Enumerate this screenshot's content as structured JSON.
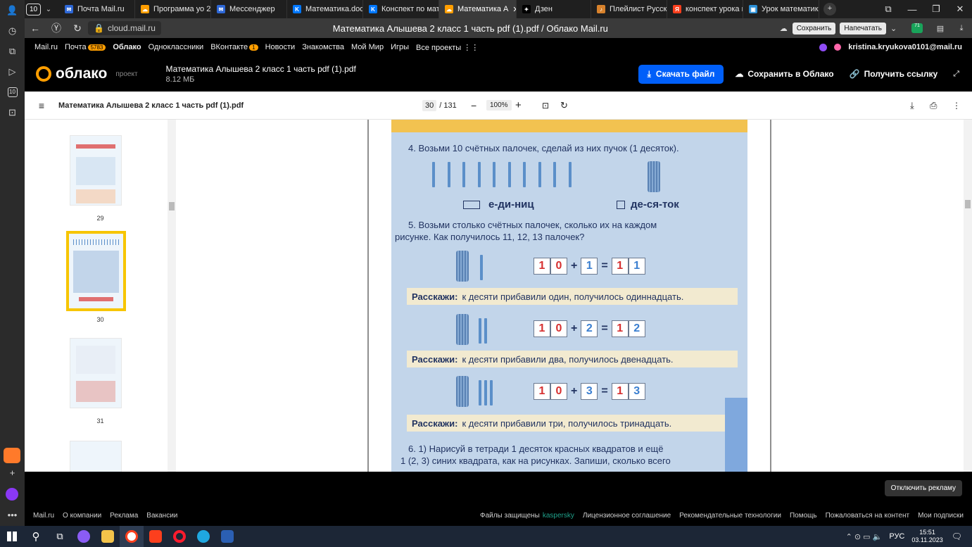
{
  "browser": {
    "tab_count": "10",
    "tabs": [
      {
        "label": "Почта Mail.ru",
        "color": "#2d67d6",
        "glyph": "✉"
      },
      {
        "label": "Программа уо 2",
        "color": "#ff9e00",
        "glyph": "☁"
      },
      {
        "label": "Мессенджер",
        "color": "#2d67d6",
        "glyph": "✉"
      },
      {
        "label": "Математика.doc",
        "color": "#0077ff",
        "glyph": "K"
      },
      {
        "label": "Конспект по мат",
        "color": "#0077ff",
        "glyph": "K"
      },
      {
        "label": "Математика А",
        "color": "#ff9e00",
        "glyph": "☁",
        "active": true
      },
      {
        "label": "Дзен",
        "color": "#000000",
        "glyph": "✦"
      },
      {
        "label": "Плейлист Русско",
        "color": "#d8822c",
        "glyph": "♪"
      },
      {
        "label": "конспект урока м",
        "color": "#fc3f1d",
        "glyph": "Я"
      },
      {
        "label": "Урок математик",
        "color": "#2a8fd6",
        "glyph": "▣"
      }
    ],
    "url": "cloud.mail.ru",
    "page_title": "Математика Алышева 2 класс 1 часть pdf (1).pdf / Облако Mail.ru",
    "save_btn": "Сохранить",
    "print_btn": "Напечатать",
    "ext_badge": "71"
  },
  "portal": {
    "links": [
      "Mail.ru",
      "Почта",
      "Облако",
      "Одноклассники",
      "ВКонтакте",
      "Новости",
      "Знакомства",
      "Мой Мир",
      "Игры",
      "Все проекты"
    ],
    "mail_badge": "5783",
    "vk_badge": "1",
    "user": "kristina.kryukova0101@mail.ru"
  },
  "cloud": {
    "logo": "облако",
    "project_label": "проект",
    "file_name": "Математика Алышева 2 класс 1 часть pdf (1).pdf",
    "file_size": "8.12 МБ",
    "download": "Скачать файл",
    "save_to_cloud": "Сохранить в Облако",
    "get_link": "Получить ссылку"
  },
  "viewer": {
    "doc_title": "Математика Алышева 2 класс 1 часть pdf (1).pdf",
    "page_current": "30",
    "page_total": "/ 131",
    "zoom": "100%",
    "thumbs": [
      "29",
      "30",
      "31"
    ]
  },
  "pdf": {
    "task4": "4. Возьми 10 счётных палочек, сделай из них пучок (1 десяток).",
    "units": "е-ди-ниц",
    "tens": "де-ся-ток",
    "task5_line1": "5. Возьми столько счётных палочек, сколько их на каждом",
    "task5_line2": "рисунке. Как получилось 11, 12, 13 палочек?",
    "say_label": "Расскажи:",
    "say1": "к десяти прибавили один, получилось одиннадцать.",
    "say2": "к десяти прибавили два, получилось двенадцать.",
    "say3": "к десяти прибавили три, получилось тринадцать.",
    "eq1": [
      "1",
      "0",
      "+",
      "1",
      "=",
      "1",
      "1"
    ],
    "eq2": [
      "1",
      "0",
      "+",
      "2",
      "=",
      "1",
      "2"
    ],
    "eq3": [
      "1",
      "0",
      "+",
      "3",
      "=",
      "1",
      "3"
    ],
    "task6_line1": "6. 1) Нарисуй в тетради 1 десяток красных квадратов и ещё",
    "task6_line2": "1 (2, 3) синих квадрата, как на рисунках. Запиши, сколько всего"
  },
  "ads": {
    "disable": "Отключить рекламу"
  },
  "footer": {
    "left": [
      "Mail.ru",
      "О компании",
      "Реклама",
      "Вакансии"
    ],
    "protected": "Файлы защищены",
    "kaspersky": "kaspersky",
    "right": [
      "Лицензионное соглашение",
      "Рекомендательные технологии",
      "Помощь",
      "Пожаловаться на контент",
      "Мои подписки"
    ]
  },
  "taskbar": {
    "lang": "РУС",
    "time": "15:51",
    "date": "03.11.2023"
  }
}
